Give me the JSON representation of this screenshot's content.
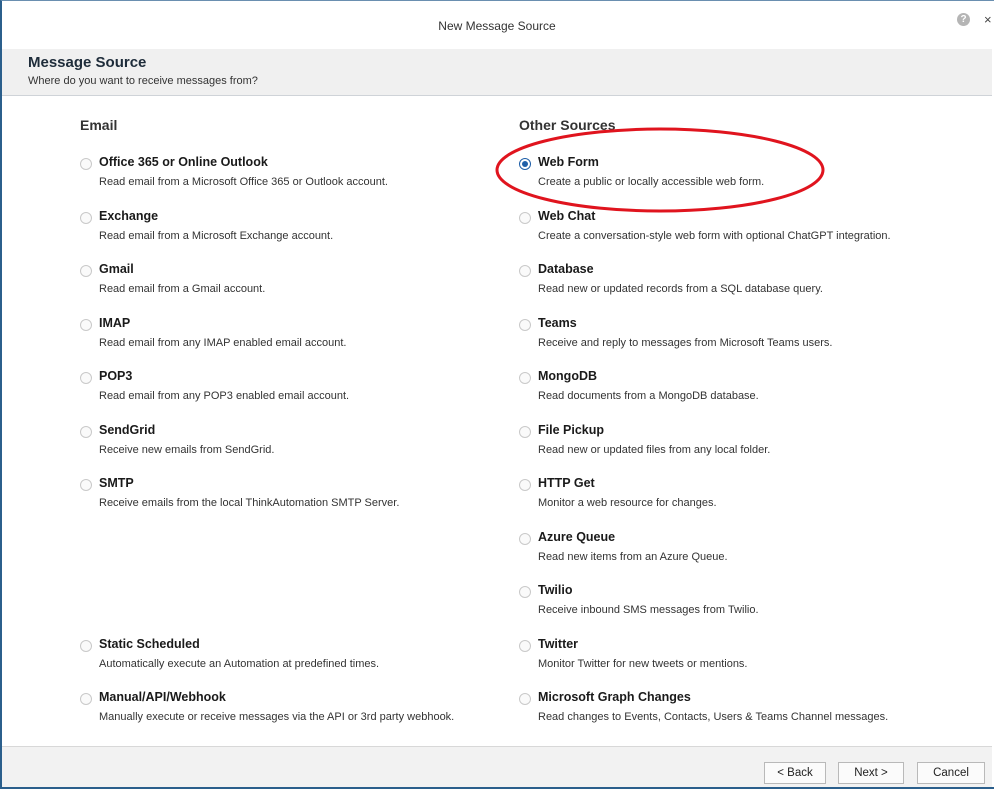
{
  "window": {
    "title": "New Message Source",
    "help_icon": "help-icon",
    "help_glyph": "?",
    "close_icon": "close-icon",
    "close_glyph": "×"
  },
  "header": {
    "title": "Message Source",
    "subtitle": "Where do you want to receive messages from?"
  },
  "columns": {
    "email_title": "Email",
    "other_title": "Other Sources"
  },
  "email_sources": [
    {
      "label": "Office 365 or Online Outlook",
      "desc": "Read email from a Microsoft Office 365 or Outlook account.",
      "selected": false
    },
    {
      "label": "Exchange",
      "desc": "Read email from a Microsoft Exchange account.",
      "selected": false
    },
    {
      "label": "Gmail",
      "desc": "Read email from a Gmail account.",
      "selected": false
    },
    {
      "label": "IMAP",
      "desc": "Read email from any IMAP enabled email account.",
      "selected": false
    },
    {
      "label": "POP3",
      "desc": "Read email from any POP3 enabled email account.",
      "selected": false
    },
    {
      "label": "SendGrid",
      "desc": "Receive new emails from SendGrid.",
      "selected": false
    },
    {
      "label": "SMTP",
      "desc": "Receive emails from the local ThinkAutomation SMTP Server.",
      "selected": false
    },
    {
      "label": "Static Scheduled",
      "desc": "Automatically execute an Automation at predefined times.",
      "selected": false
    },
    {
      "label": "Manual/API/Webhook",
      "desc": "Manually execute or receive messages via the API or 3rd party webhook.",
      "selected": false
    }
  ],
  "other_sources": [
    {
      "label": "Web Form",
      "desc": "Create a public or locally accessible web form.",
      "selected": true
    },
    {
      "label": "Web Chat",
      "desc": "Create a conversation-style web form with optional ChatGPT integration.",
      "selected": false
    },
    {
      "label": "Database",
      "desc": "Read new or updated records from a SQL database query.",
      "selected": false
    },
    {
      "label": "Teams",
      "desc": "Receive and reply to messages from Microsoft Teams users.",
      "selected": false
    },
    {
      "label": "MongoDB",
      "desc": "Read documents from a MongoDB database.",
      "selected": false
    },
    {
      "label": "File Pickup",
      "desc": "Read new or updated files from any local folder.",
      "selected": false
    },
    {
      "label": "HTTP Get",
      "desc": "Monitor a web resource for changes.",
      "selected": false
    },
    {
      "label": "Azure Queue",
      "desc": "Read new items from an Azure Queue.",
      "selected": false
    },
    {
      "label": "Twilio",
      "desc": "Receive inbound SMS messages from Twilio.",
      "selected": false
    },
    {
      "label": "Twitter",
      "desc": "Monitor Twitter for new tweets or mentions.",
      "selected": false
    },
    {
      "label": "Microsoft Graph Changes",
      "desc": "Read changes to Events, Contacts, Users & Teams Channel messages.",
      "selected": false
    }
  ],
  "buttons": {
    "back": "< Back",
    "next": "Next >",
    "cancel": "Cancel"
  },
  "colors": {
    "highlight_ellipse": "#e0141e",
    "radio_selected": "#1f5fa8"
  }
}
